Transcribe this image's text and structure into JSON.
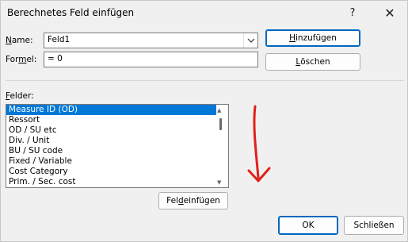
{
  "window": {
    "title": "Berechnetes Feld einfügen",
    "help_glyph": "?",
    "close_glyph": "✕"
  },
  "form": {
    "name_label_key": "N",
    "name_label_rest": "ame:",
    "name_value": "Feld1",
    "formula_label_pre": "For",
    "formula_label_key": "m",
    "formula_label_rest": "el:",
    "formula_value": "= 0"
  },
  "buttons": {
    "add_key": "H",
    "add_rest": "inzufügen",
    "delete_key": "L",
    "delete_rest": "öschen",
    "insert_field_pre": "Fel",
    "insert_field_key": "d",
    "insert_field_rest": " einfügen",
    "ok": "OK",
    "close": "Schließen"
  },
  "fields": {
    "label_key": "F",
    "label_rest": "elder:",
    "items": [
      "Measure ID (OD)",
      "Ressort",
      "OD / SU etc",
      "Div. / Unit",
      "BU / SU code",
      "Fixed / Variable",
      "Cost Category",
      "Prim. / Sec. cost"
    ],
    "selected_index": 0
  },
  "annotation": {
    "arrow_color": "#e0201c"
  }
}
